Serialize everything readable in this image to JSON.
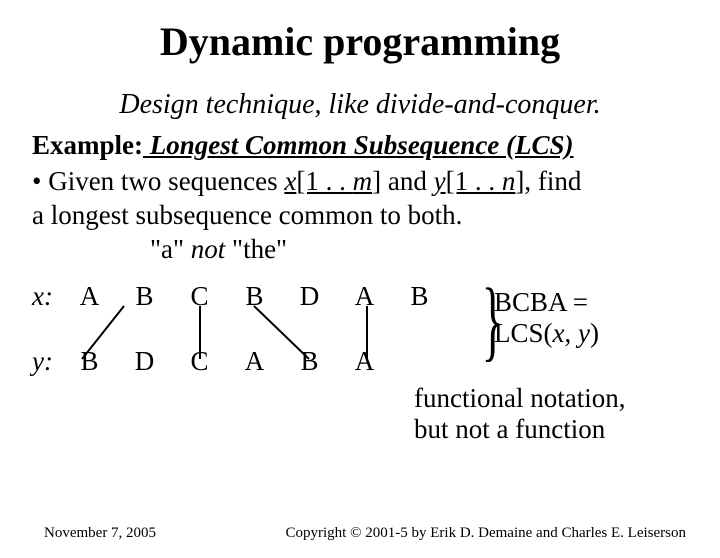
{
  "title": "Dynamic programming",
  "subtitle": "Design technique, like divide-and-conquer.",
  "example_label": "Example:",
  "example_title": " Longest Common Subsequence (LCS)",
  "bullet_prefix": "• Given two sequences ",
  "x_var": "x",
  "x_range": "[1 . . ",
  "m_var": "m",
  "and_text": "] and ",
  "y_var": "y",
  "y_range": "[1 . . ",
  "n_var": "n",
  "bullet_suffix": "], find",
  "bullet_line2": "a longest subsequence common to both. ",
  "note_a": "\"a\"",
  "note_not": " not ",
  "note_the": "\"the\"",
  "seq": {
    "x_label": "x:",
    "y_label": "y:",
    "x": [
      "A",
      "B",
      "C",
      "B",
      "D",
      "A",
      "B"
    ],
    "y": [
      "B",
      "D",
      "C",
      "A",
      "B",
      "A"
    ]
  },
  "rhs_line1": "BCBA = ",
  "rhs_line2a": "LCS(",
  "rhs_x": "x",
  "rhs_comma": ", ",
  "rhs_y": "y",
  "rhs_line2b": ")",
  "func_note1": "functional notation,",
  "func_note2": "but not a function",
  "footer_date": "November 7, 2005",
  "footer_copy": "Copyright © 2001-5 by Erik D. Demaine and Charles E. Leiserson"
}
